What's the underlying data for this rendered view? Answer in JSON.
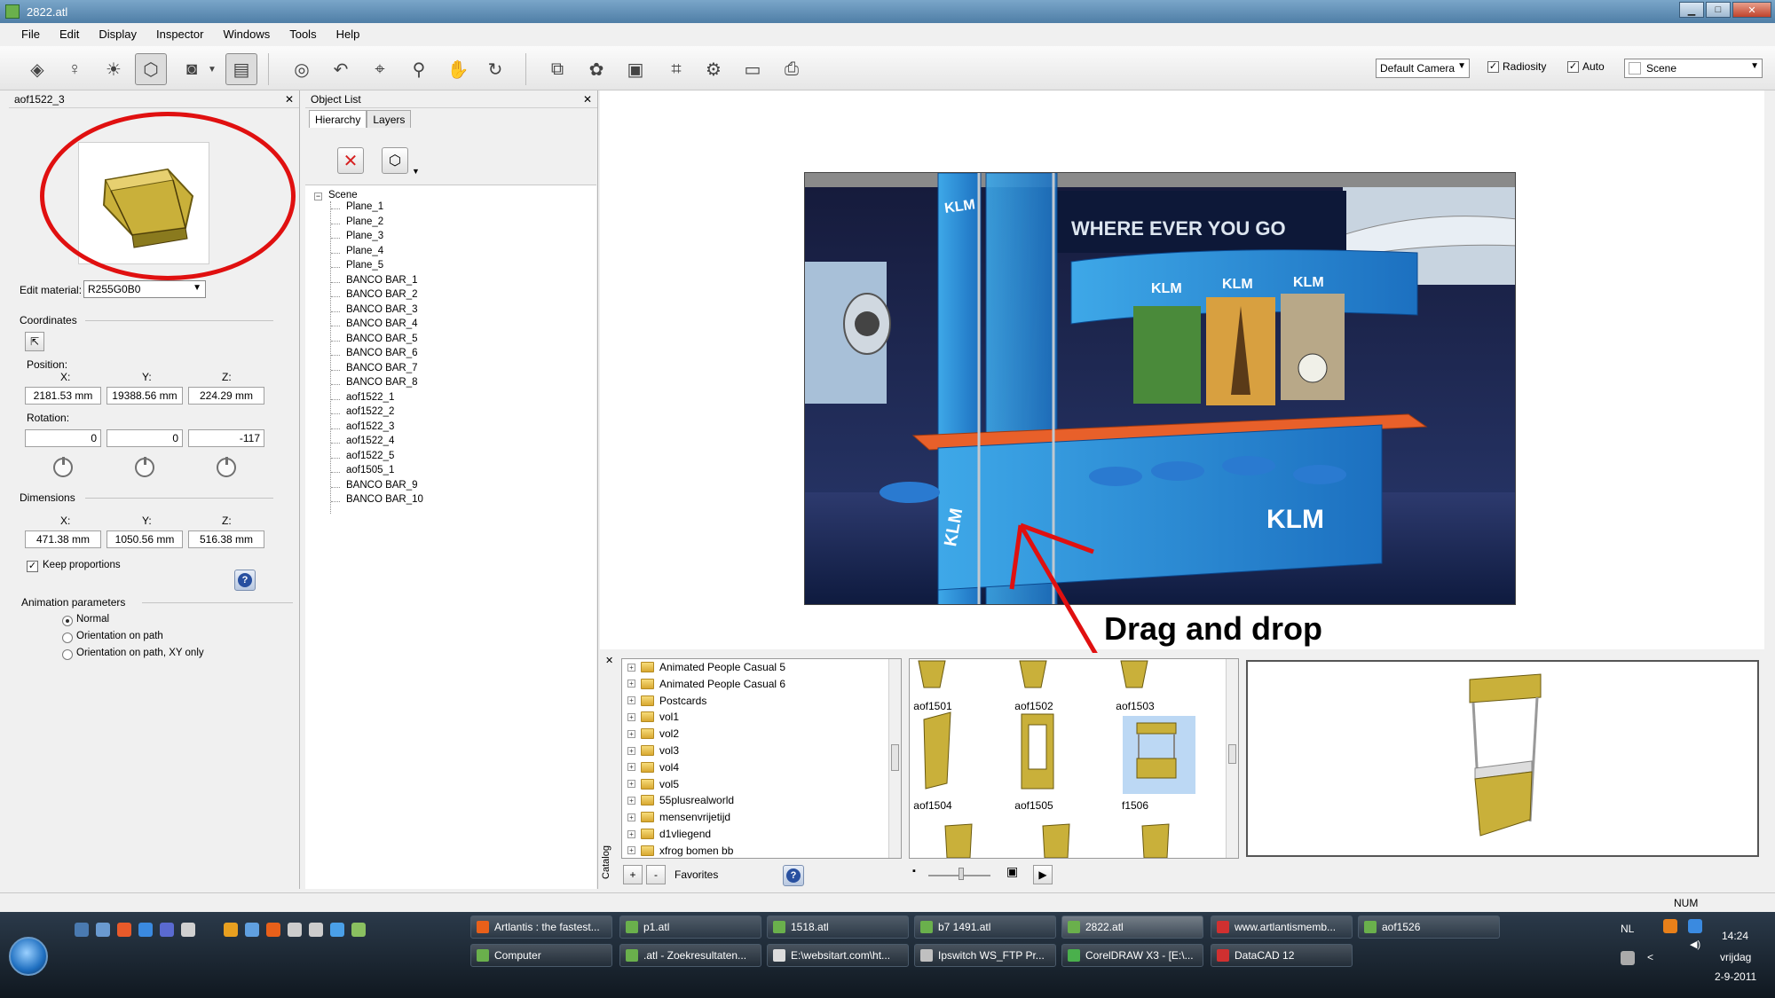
{
  "window": {
    "title": "2822.atl"
  },
  "menu": [
    "File",
    "Edit",
    "Display",
    "Inspector",
    "Windows",
    "Tools",
    "Help"
  ],
  "toolbar": {
    "camera_select": "Default Camera",
    "radiosity_label": "Radiosity",
    "radiosity_checked": true,
    "auto_label": "Auto",
    "auto_checked": true,
    "scene_select": "Scene"
  },
  "inspector": {
    "title": "aof1522_3",
    "edit_material_label": "Edit material:",
    "edit_material_value": "R255G0B0",
    "coordinates_label": "Coordinates",
    "position_label": "Position:",
    "axis_x": "X:",
    "axis_y": "Y:",
    "axis_z": "Z:",
    "position": {
      "x": "2181.53 mm",
      "y": "19388.56 mm",
      "z": "224.29 mm"
    },
    "rotation_label": "Rotation:",
    "rotation": {
      "x": "0",
      "y": "0",
      "z": "-117"
    },
    "dimensions_label": "Dimensions",
    "dimensions": {
      "x": "471.38 mm",
      "y": "1050.56 mm",
      "z": "516.38 mm"
    },
    "keep_proportions_label": "Keep proportions",
    "keep_proportions_checked": true,
    "animation_label": "Animation parameters",
    "animation_options": [
      "Normal",
      "Orientation on path",
      "Orientation on path, XY only"
    ],
    "animation_selected": "Normal"
  },
  "object_list": {
    "title": "Object List",
    "tabs": [
      "Hierarchy",
      "Layers"
    ],
    "active_tab": "Hierarchy",
    "root": "Scene",
    "items": [
      "Plane_1",
      "Plane_2",
      "Plane_3",
      "Plane_4",
      "Plane_5",
      "BANCO BAR_1",
      "BANCO BAR_2",
      "BANCO BAR_3",
      "BANCO BAR_4",
      "BANCO BAR_5",
      "BANCO BAR_6",
      "BANCO BAR_7",
      "BANCO BAR_8",
      "aof1522_1",
      "aof1522_2",
      "aof1522_3",
      "aof1522_4",
      "aof1522_5",
      "aof1505_1",
      "BANCO BAR_9",
      "BANCO BAR_10"
    ]
  },
  "render": {
    "banner_text": "WHERE EVER YOU GO",
    "brand": "KLM"
  },
  "annotation": {
    "drag_label": "Drag and drop"
  },
  "catalog": {
    "tab_label": "Catalog",
    "folders": [
      "Animated People Casual 5",
      "Animated People Casual 6",
      "Postcards",
      "vol1",
      "vol2",
      "vol3",
      "vol4",
      "vol5",
      "55plusrealworld",
      "mensenvrijetijd",
      "d1vliegend",
      "xfrog bomen bb"
    ],
    "favorites_label": "Favorites",
    "grid_items": [
      "aof1501",
      "aof1502",
      "aof1503",
      "aof1504",
      "aof1505",
      "f1506"
    ],
    "selected_item": "f1506"
  },
  "statusbar": {
    "num": "NUM"
  },
  "taskbar": {
    "row1": [
      "Artlantis : the fastest...",
      "p1.atl",
      "1518.atl",
      "b7 1491.atl",
      "2822.atl",
      "www.artlantismemb...",
      "aof1526"
    ],
    "row2": [
      "Computer",
      ".atl - Zoekresultaten...",
      "E:\\websitart.com\\ht...",
      "Ipswitch WS_FTP Pr...",
      "CorelDRAW X3 - [E:\\...",
      "DataCAD 12"
    ],
    "active": "2822.atl",
    "language": "NL",
    "time": "14:24",
    "day": "vrijdag",
    "date": "2-9-2011"
  }
}
